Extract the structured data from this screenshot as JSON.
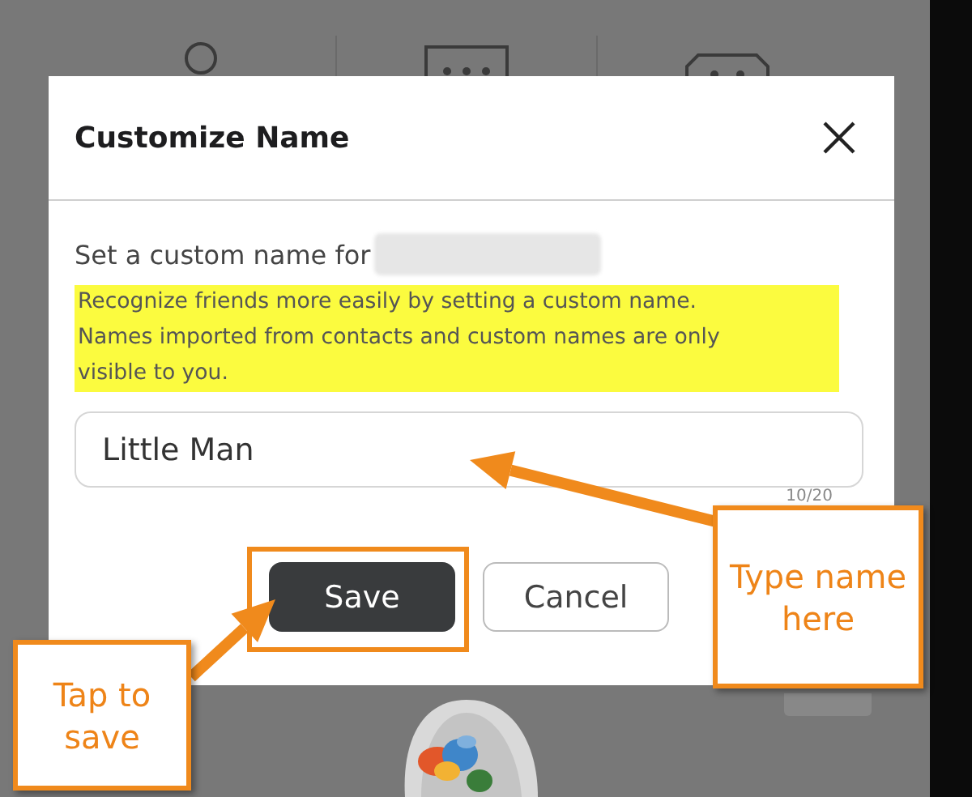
{
  "dialog": {
    "title": "Customize Name",
    "prompt": "Set a custom name for",
    "note": "Recognize friends more easily by setting a custom name. Names imported from contacts and custom names are only visible to you.",
    "name_field": {
      "value": "Little Man"
    },
    "counter": "10/20",
    "buttons": [
      {
        "label": "Save",
        "kind": "primary"
      },
      {
        "label": "Cancel",
        "kind": "secondary"
      }
    ]
  },
  "callouts": [
    {
      "text": "Type name here",
      "kind": "type"
    },
    {
      "text": "Tap to save",
      "kind": "save"
    }
  ]
}
